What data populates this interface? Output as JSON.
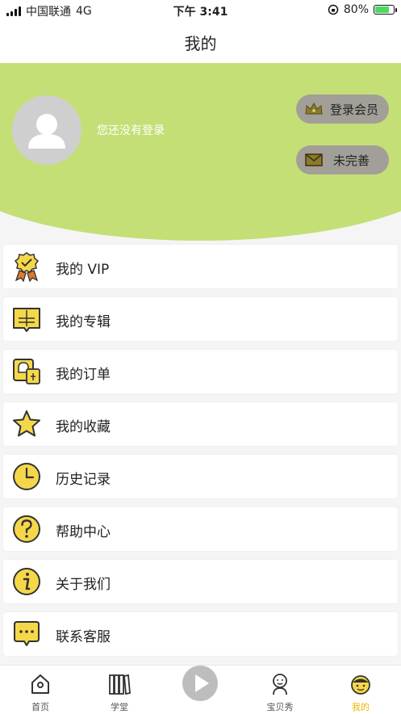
{
  "status_bar": {
    "carrier": "中国联通",
    "network": "4G",
    "time": "下午 3:41",
    "battery": "80%"
  },
  "nav": {
    "title": "我的"
  },
  "profile": {
    "login_hint": "您还没有登录",
    "vip_button": "登录会员",
    "info_button": "未完善",
    "accent_color": "#c4df76"
  },
  "menu": {
    "items": [
      {
        "label": "我的 VIP",
        "icon": "vip-badge-icon"
      },
      {
        "label": "我的专辑",
        "icon": "album-icon"
      },
      {
        "label": "我的订单",
        "icon": "order-icon"
      },
      {
        "label": "我的收藏",
        "icon": "star-icon"
      },
      {
        "label": "历史记录",
        "icon": "clock-icon"
      },
      {
        "label": "帮助中心",
        "icon": "help-icon"
      },
      {
        "label": "关于我们",
        "icon": "info-icon"
      },
      {
        "label": "联系客服",
        "icon": "chat-icon"
      }
    ]
  },
  "tabs": {
    "items": [
      {
        "label": "首页",
        "icon": "home-icon"
      },
      {
        "label": "学堂",
        "icon": "books-icon"
      },
      {
        "label": "",
        "icon": "play-icon"
      },
      {
        "label": "宝贝秀",
        "icon": "baby-icon"
      },
      {
        "label": "我的",
        "icon": "profile-icon",
        "active": true
      }
    ],
    "active_color": "#f2b300"
  }
}
